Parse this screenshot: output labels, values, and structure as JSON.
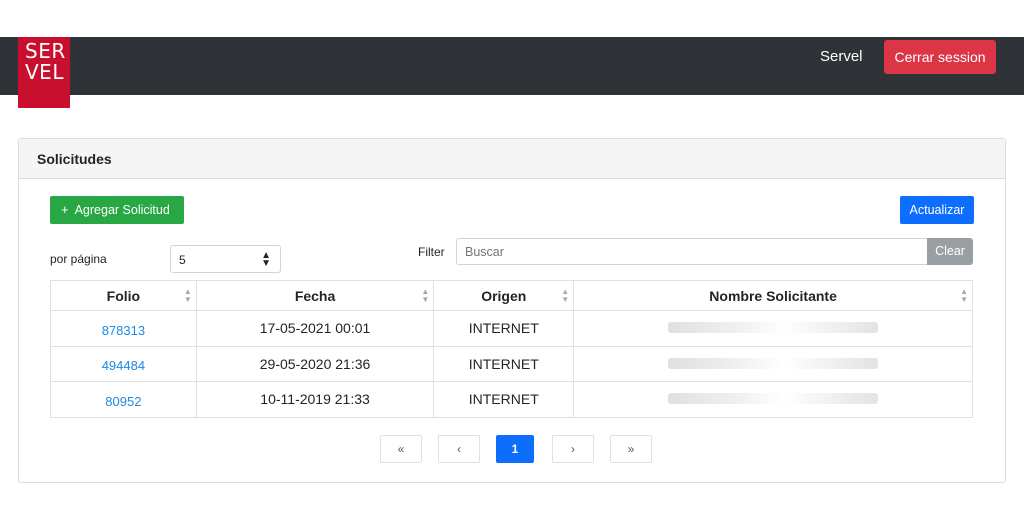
{
  "header": {
    "logo_line1": "SER",
    "logo_line2": "VEL",
    "user_name": "Servel",
    "logout_label": "Cerrar session"
  },
  "card": {
    "title": "Solicitudes",
    "add_label": "Agregar Solicitud",
    "refresh_label": "Actualizar"
  },
  "controls": {
    "per_page_label": "por página",
    "per_page_value": "5",
    "filter_label": "Filter",
    "search_placeholder": "Buscar",
    "clear_label": "Clear"
  },
  "table": {
    "columns": [
      "Folio",
      "Fecha",
      "Origen",
      "Nombre Solicitante"
    ],
    "rows": [
      {
        "folio": "878313",
        "fecha": "17-05-2021 00:01",
        "origen": "INTERNET"
      },
      {
        "folio": "494484",
        "fecha": "29-05-2020 21:36",
        "origen": "INTERNET"
      },
      {
        "folio": "80952",
        "fecha": "10-11-2019 21:33",
        "origen": "INTERNET"
      }
    ]
  },
  "pagination": {
    "first": "«",
    "prev": "‹",
    "current": "1",
    "next": "›",
    "last": "»"
  },
  "colors": {
    "navbar": "#2f3236",
    "logo": "#c8102e",
    "danger": "#dc3545",
    "success": "#28a745",
    "primary": "#0d6efd",
    "link": "#1e88e5"
  }
}
